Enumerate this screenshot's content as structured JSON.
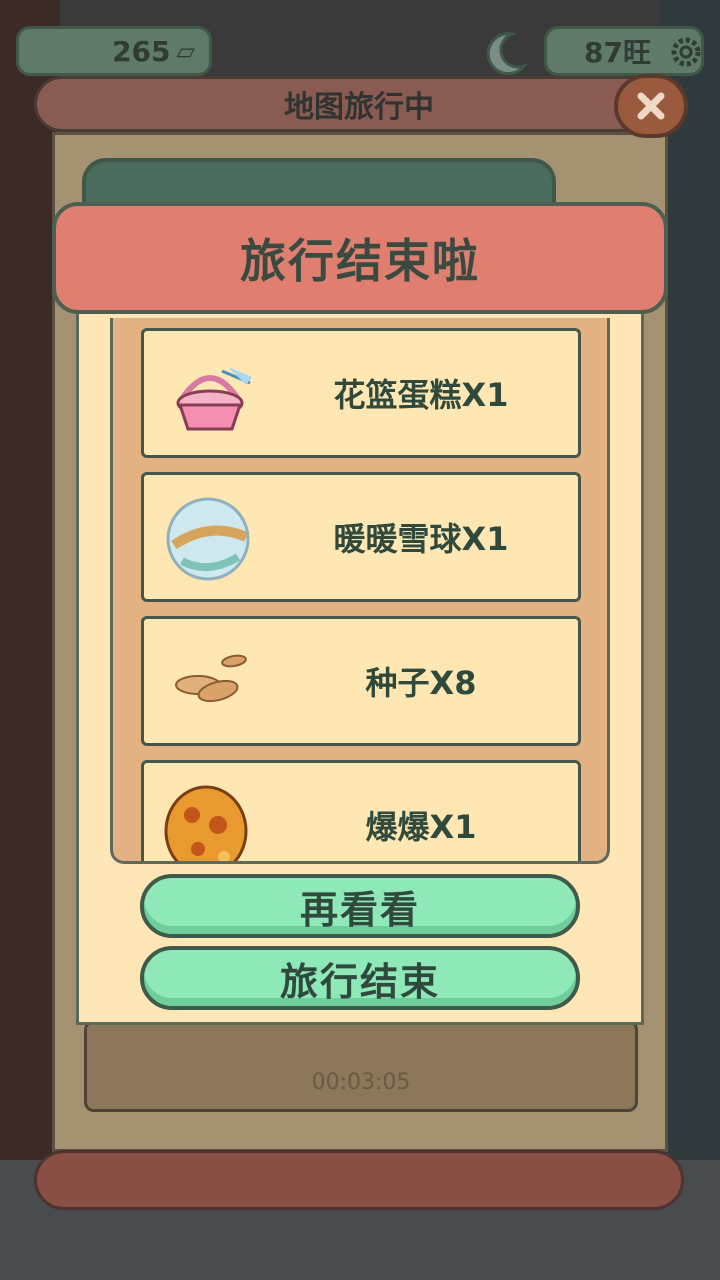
{
  "hud": {
    "coins": "265",
    "energy": "87旺"
  },
  "board": {
    "title": "地图旅行中",
    "timer": "00:03:05"
  },
  "popup": {
    "title": "旅行结束啦",
    "rewards": [
      {
        "label": "花篮蛋糕X1",
        "icon": "flower-basket-cake-icon"
      },
      {
        "label": "暖暖雪球X1",
        "icon": "snow-globe-icon"
      },
      {
        "label": "种子X8",
        "icon": "seeds-icon"
      },
      {
        "label": "爆爆X1",
        "icon": "orange-egg-icon"
      }
    ],
    "again_label": "再看看",
    "end_label": "旅行结束"
  },
  "colors": {
    "header": "#e07f70",
    "card": "#ffe6b7",
    "button": "#8fe8b8",
    "text": "#2f4a3c"
  }
}
